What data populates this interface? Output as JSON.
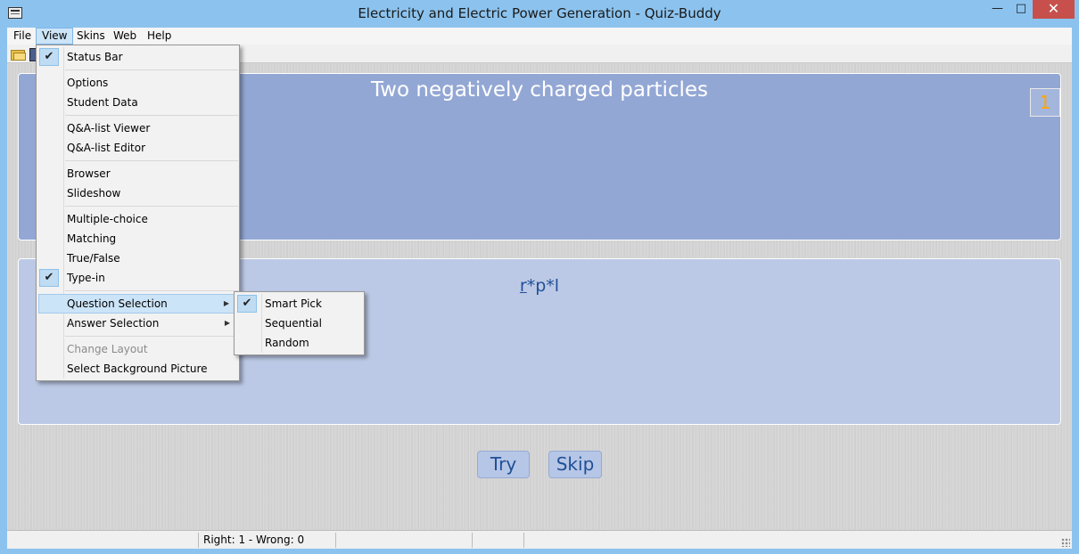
{
  "window": {
    "title": "Electricity and Electric Power Generation - Quiz-Buddy",
    "minimize": "—",
    "maximize": "□",
    "close": "✕"
  },
  "menubar": [
    "File",
    "View",
    "Skins",
    "Web",
    "Help"
  ],
  "view_menu": {
    "status_bar": "Status Bar",
    "options": "Options",
    "student_data": "Student Data",
    "qa_list_viewer": "Q&A-list Viewer",
    "qa_list_editor": "Q&A-list Editor",
    "browser": "Browser",
    "slideshow": "Slideshow",
    "multiple_choice": "Multiple-choice",
    "matching": "Matching",
    "true_false": "True/False",
    "type_in": "Type-in",
    "question_selection": "Question Selection",
    "answer_selection": "Answer Selection",
    "change_layout": "Change Layout",
    "select_background_picture": "Select Background Picture"
  },
  "submenu": {
    "smart_pick": "Smart Pick",
    "sequential": "Sequential",
    "random": "Random"
  },
  "checkmark": "✔",
  "submenu_arrow": "▶",
  "quiz": {
    "question": "Two negatively charged particles",
    "question_number": "1",
    "answer_hint_first": "r",
    "answer_hint_rest": "*p*l"
  },
  "buttons": {
    "try": "Try",
    "skip": "Skip"
  },
  "status": {
    "score": "Right: 1 - Wrong: 0"
  },
  "icons": {
    "toolbar": [
      "folder-open-icon",
      "save-icon"
    ]
  }
}
